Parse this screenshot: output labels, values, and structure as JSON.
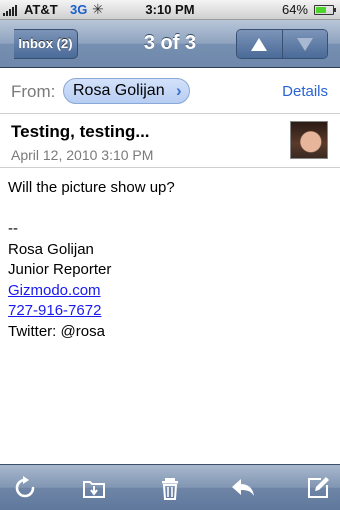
{
  "status_bar": {
    "carrier": "AT&T",
    "network": "3G",
    "activity": "✳",
    "time": "3:10 PM",
    "battery": "64%",
    "battery_level": 0.64
  },
  "nav": {
    "back_label": "Inbox (2)",
    "title": "3 of 3",
    "prev_icon": "up-arrow-icon",
    "next_icon": "down-arrow-icon"
  },
  "header": {
    "from_label": "From:",
    "sender": "Rosa Golijan",
    "details_label": "Details"
  },
  "message": {
    "subject": "Testing, testing...",
    "date": "April 12, 2010 3:10 PM",
    "body_lines": [
      {
        "text": "Will the picture show up?",
        "link": false
      },
      {
        "text": "",
        "link": false
      },
      {
        "text": "--",
        "link": false
      },
      {
        "text": "Rosa Golijan",
        "link": false
      },
      {
        "text": "Junior Reporter",
        "link": false
      },
      {
        "text": "Gizmodo.com",
        "link": true
      },
      {
        "text": "727-916-7672",
        "link": true
      },
      {
        "text": "Twitter: @rosa",
        "link": false
      }
    ]
  },
  "toolbar": {
    "icons": [
      "refresh-icon",
      "move-folder-icon",
      "trash-icon",
      "reply-icon",
      "compose-icon"
    ]
  },
  "colors": {
    "link": "#1a1aee",
    "details": "#2a63d4",
    "nav_bar": "#7690b2"
  }
}
